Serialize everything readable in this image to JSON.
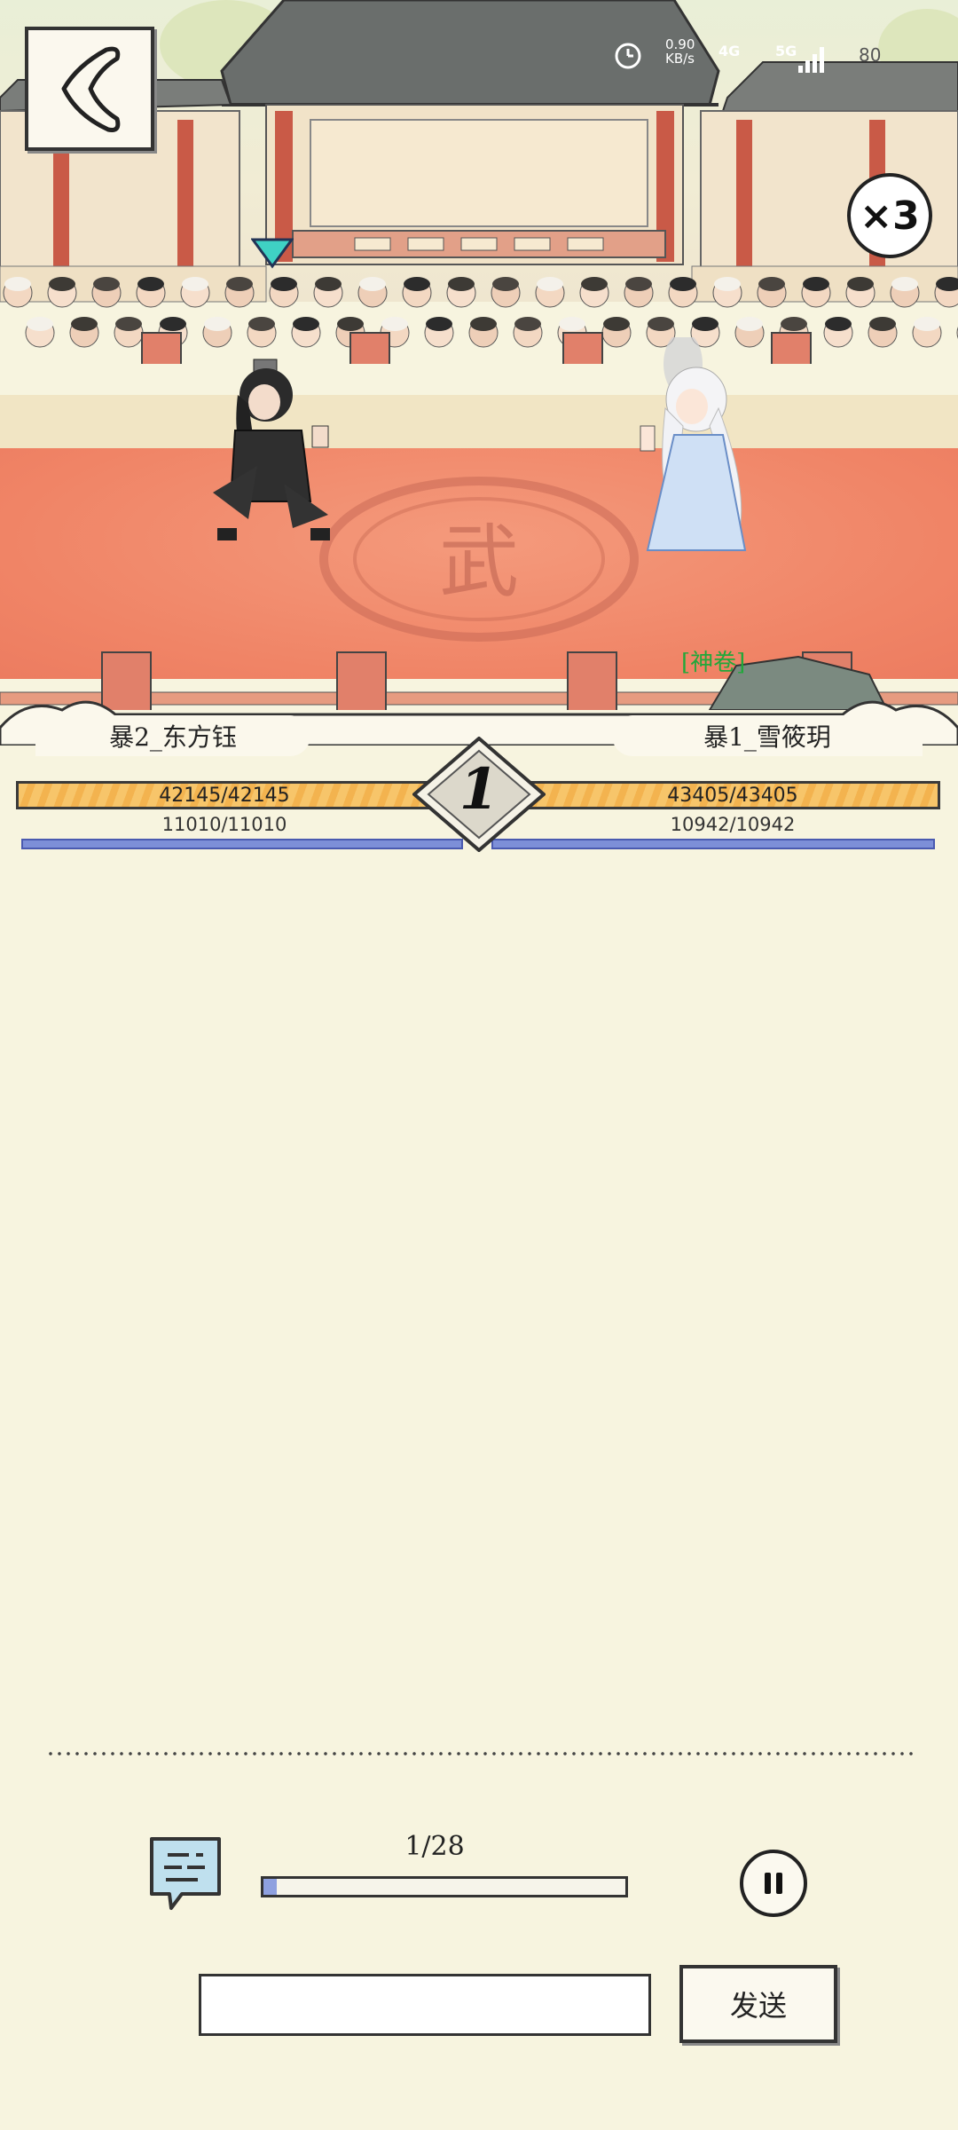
{
  "status_bar": {
    "network_speed": "0.90",
    "network_unit": "KB/s",
    "network_4g": "4G",
    "network_5g": "5G",
    "battery": "80"
  },
  "battle": {
    "speed_multiplier": "×3",
    "round": "1",
    "floor_emblem": "武",
    "enemy_tag": "[神卷]",
    "colors": {
      "hp": "#f3b34f",
      "mp": "#7d8fd8",
      "floor": "#f08466"
    }
  },
  "left_fighter": {
    "name": "暴2_东方钰",
    "hp": "42145/42145",
    "mp": "11010/11010"
  },
  "right_fighter": {
    "name": "暴1_雪筱玥",
    "hp": "43405/43405",
    "mp": "10942/10942"
  },
  "controls": {
    "progress_label": "1/28",
    "progress": 0.0357,
    "message_value": "",
    "send_label": "发送"
  }
}
